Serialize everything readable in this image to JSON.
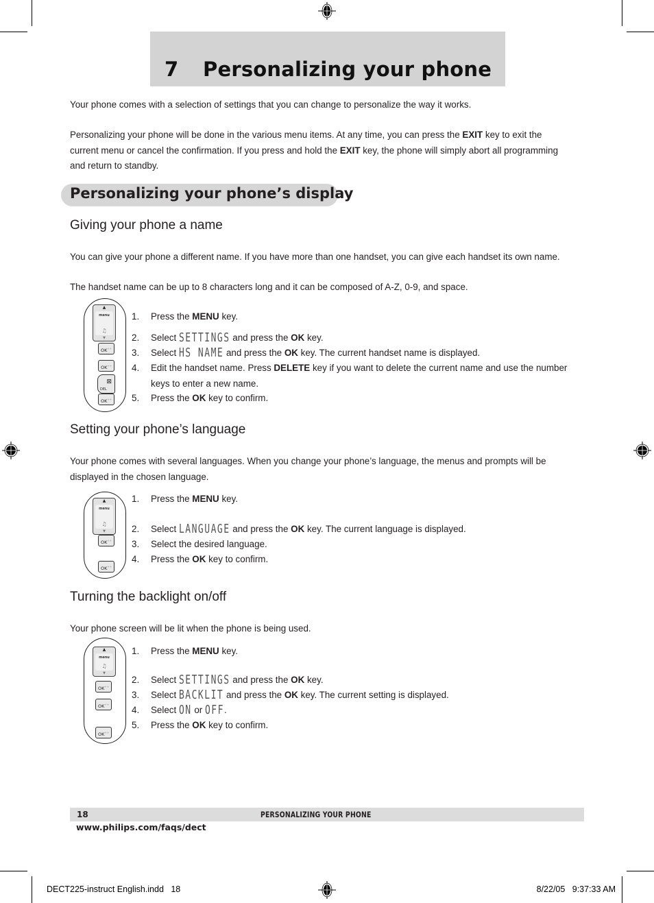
{
  "chapter": {
    "number": "7",
    "title": "Personalizing your phone"
  },
  "intro": [
    "Your phone comes with a selection of settings that you can change to personalize the way it works.",
    {
      "parts": [
        {
          "text": "Personalizing your phone will be done in the various menu items.  At any time, you can press the "
        },
        {
          "text": "EXIT",
          "bold": true
        },
        {
          "text": " key to exit the current menu or cancel the confirmation.  If you press and hold the "
        },
        {
          "text": "EXIT",
          "bold": true
        },
        {
          "text": " key, the phone will simply abort all programming and return to standby."
        }
      ]
    }
  ],
  "section_title": "Personalizing your phone’s display",
  "subsections": [
    {
      "title": "Giving your phone a name",
      "paragraphs": [
        "You can give your phone a different name.  If you have more than one handset, you can give each handset its own name.",
        "The handset name can be up to 8 characters long and it can be composed of A-Z, 0-9, and space."
      ],
      "steps": [
        {
          "n": "1.",
          "parts": [
            {
              "text": "Press the "
            },
            {
              "text": "MENU",
              "bold": true
            },
            {
              "text": " key."
            }
          ]
        },
        {
          "n": "2.",
          "parts": [
            {
              "text": "Select "
            },
            {
              "text": "SETTINGS",
              "lcd": true
            },
            {
              "text": " and press the "
            },
            {
              "text": "OK",
              "bold": true
            },
            {
              "text": " key."
            }
          ]
        },
        {
          "n": "3.",
          "parts": [
            {
              "text": "Select "
            },
            {
              "text": "HS NAME",
              "lcd": true
            },
            {
              "text": " and press the "
            },
            {
              "text": "OK",
              "bold": true
            },
            {
              "text": " key.  The current handset name is displayed."
            }
          ]
        },
        {
          "n": "4.",
          "parts": [
            {
              "text": "Edit the handset name.  Press "
            },
            {
              "text": "DELETE",
              "bold": true
            },
            {
              "text": " key if you want to delete the current name and use the number keys to enter a new name."
            }
          ]
        },
        {
          "n": "5.",
          "parts": [
            {
              "text": "Press the "
            },
            {
              "text": "OK",
              "bold": true
            },
            {
              "text": " key to confirm."
            }
          ]
        }
      ],
      "keys": [
        "menu-nav",
        "OK",
        "OK",
        "DEL",
        "OK"
      ]
    },
    {
      "title": "Setting your phone’s language",
      "paragraphs": [
        "Your phone comes with several languages.  When you change your phone’s language, the menus and prompts will be displayed in the chosen language."
      ],
      "steps": [
        {
          "n": "1.",
          "parts": [
            {
              "text": "Press the "
            },
            {
              "text": "MENU",
              "bold": true
            },
            {
              "text": " key."
            }
          ]
        },
        {
          "n": "2.",
          "parts": [
            {
              "text": "Select "
            },
            {
              "text": "LANGUAGE",
              "lcd": true
            },
            {
              "text": " and press the "
            },
            {
              "text": "OK",
              "bold": true
            },
            {
              "text": " key.  The current language is displayed."
            }
          ]
        },
        {
          "n": "3.",
          "parts": [
            {
              "text": "Select the desired language."
            }
          ]
        },
        {
          "n": "4.",
          "parts": [
            {
              "text": "Press the "
            },
            {
              "text": "OK",
              "bold": true
            },
            {
              "text": " key to confirm."
            }
          ]
        }
      ],
      "keys": [
        "menu-nav",
        "OK",
        "OK"
      ]
    },
    {
      "title": "Turning the backlight on/off",
      "paragraphs": [
        "Your phone screen will be lit when the phone is being used."
      ],
      "steps": [
        {
          "n": "1.",
          "parts": [
            {
              "text": "Press the "
            },
            {
              "text": "MENU",
              "bold": true
            },
            {
              "text": " key."
            }
          ]
        },
        {
          "n": "2.",
          "parts": [
            {
              "text": "Select "
            },
            {
              "text": "SETTINGS",
              "lcd": true
            },
            {
              "text": " and press the "
            },
            {
              "text": "OK",
              "bold": true
            },
            {
              "text": " key."
            }
          ]
        },
        {
          "n": "3.",
          "parts": [
            {
              "text": "Select "
            },
            {
              "text": "BACKLIT",
              "lcd": true
            },
            {
              "text": " and press the "
            },
            {
              "text": "OK",
              "bold": true
            },
            {
              "text": " key.  The current setting is displayed."
            }
          ]
        },
        {
          "n": "4.",
          "parts": [
            {
              "text": "Select "
            },
            {
              "text": "ON",
              "lcd": true
            },
            {
              "text": " or "
            },
            {
              "text": "OFF",
              "lcd": true
            },
            {
              "text": "."
            }
          ]
        },
        {
          "n": "5.",
          "parts": [
            {
              "text": "Press the "
            },
            {
              "text": "OK",
              "bold": true
            },
            {
              "text": " key to confirm."
            }
          ]
        }
      ],
      "keys": [
        "menu-nav",
        "OK",
        "OK",
        "OK"
      ]
    }
  ],
  "keypad_labels": {
    "menu": "menu",
    "ok": "OK",
    "del": "DEL"
  },
  "footer": {
    "page_number": "18",
    "running_title": "PERSONALIZING YOUR PHONE",
    "url": "www.philips.com/faqs/dect"
  },
  "slug": {
    "file": "DECT225-instruct English.indd   18",
    "timestamp": "8/22/05   9:37:33 AM"
  },
  "colors": {
    "band_gray": "#d3d3d3",
    "pill_gray": "#d6d6d6",
    "text": "#231f20"
  }
}
